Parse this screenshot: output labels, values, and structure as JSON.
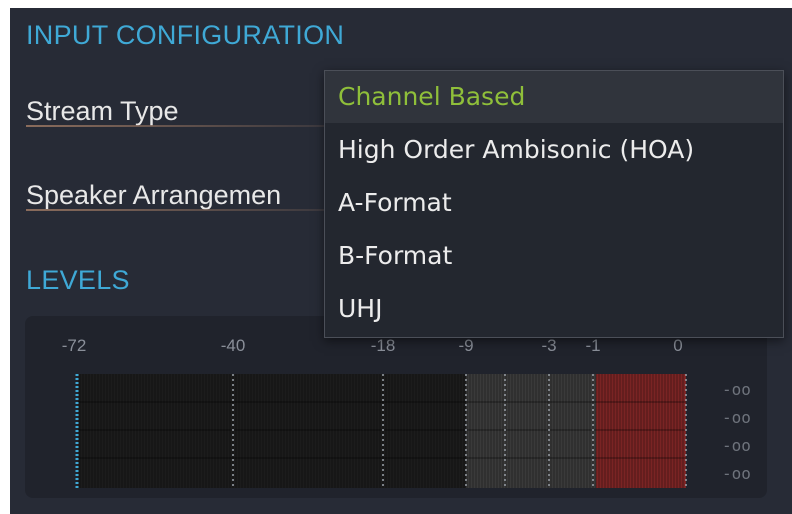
{
  "input_config": {
    "title": "INPUT CONFIGURATION",
    "stream_type_label": "Stream Type",
    "speaker_arrangement_label": "Speaker Arrangemen"
  },
  "stream_type_dropdown": {
    "selected": "Channel Based",
    "options": [
      "Channel Based",
      "High Order Ambisonic (HOA)",
      "A-Format",
      "B-Format",
      "UHJ"
    ],
    "selected_color": "#8fbf3a"
  },
  "levels": {
    "title": "LEVELS",
    "scale_labels": [
      "-72",
      "-40",
      "-18",
      "-9",
      "-3",
      "-1",
      "0"
    ],
    "channel_readouts": [
      "-oo",
      "-oo",
      "-oo",
      "-oo"
    ],
    "zone_colors": {
      "low": "#1c1c1c",
      "mid": "#3a3a3a",
      "high": "#7a2424"
    }
  }
}
